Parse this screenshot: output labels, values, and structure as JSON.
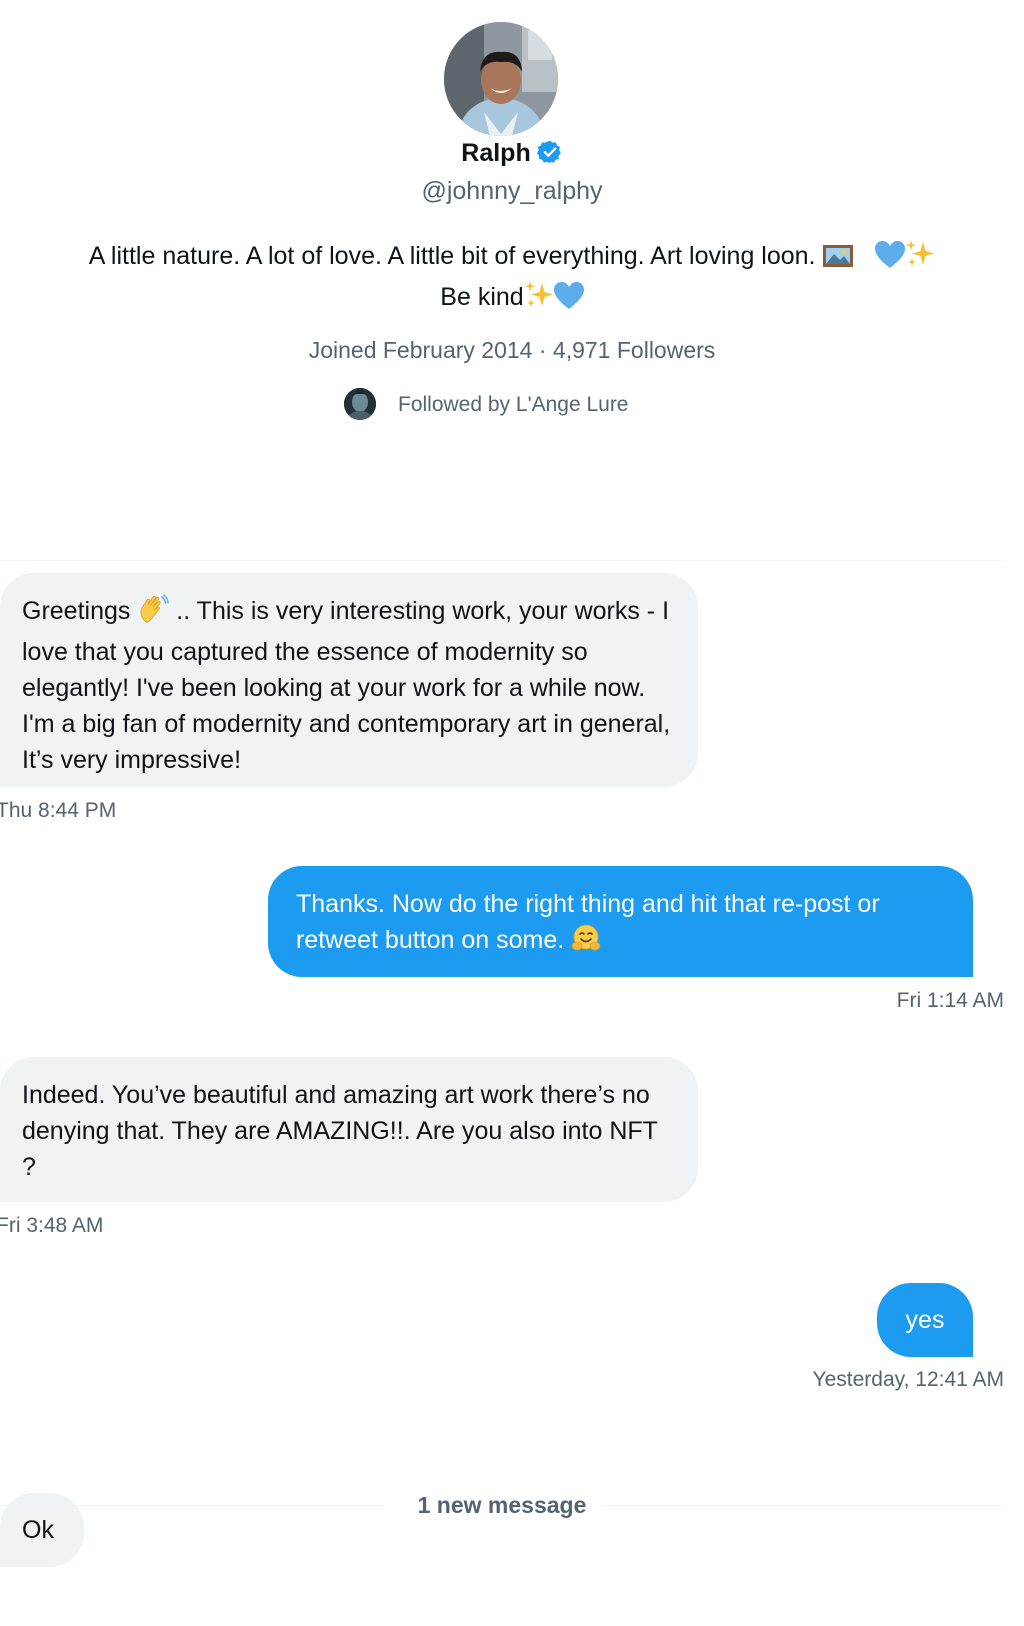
{
  "profile": {
    "name": "Ralph",
    "handle": "@johnny_ralphy",
    "bio_line1": "A little nature. A lot of love. A little bit of everything. Art loving loon.",
    "bio_line2": "Be kind",
    "joined": "Joined February 2014",
    "separator": "·",
    "followers": "4,971 Followers",
    "followed_by": "Followed by L'Ange Lure"
  },
  "messages": [
    {
      "direction": "incoming",
      "text_part1": "Greetings",
      "text_part2": ".. This is very interesting work, your works - I love that you captured the essence of modernity so elegantly! I've been looking at your work for a while now. I'm a big fan of modernity and contemporary art in general, It’s very impressive!",
      "time": "Thu 8:44 PM"
    },
    {
      "direction": "outgoing",
      "text": "Thanks. Now do the right thing and hit that re-post or retweet button on some.",
      "time": "Fri 1:14 AM"
    },
    {
      "direction": "incoming",
      "text": "Indeed. You’ve beautiful and amazing art work there’s no denying that. They are AMAZING!!. Are you also into NFT ?",
      "time": "Fri 3:48 AM"
    },
    {
      "direction": "outgoing",
      "text": "yes",
      "time": "Yesterday, 12:41 AM"
    },
    {
      "direction": "incoming",
      "text": "Ok"
    }
  ],
  "new_message_divider": "1 new message",
  "icons": {
    "verified": "verified-badge-icon",
    "framed_picture": "framed-picture-emoji",
    "blue_heart": "blue-heart-emoji",
    "sparkles": "sparkles-emoji",
    "waving_hand": "waving-hand-emoji",
    "hugging_face": "hugging-face-emoji"
  },
  "colors": {
    "accent": "#1d9bf0",
    "incoming_bubble": "#eff3f4",
    "secondary_text": "#536471",
    "primary_text": "#0f1419"
  }
}
